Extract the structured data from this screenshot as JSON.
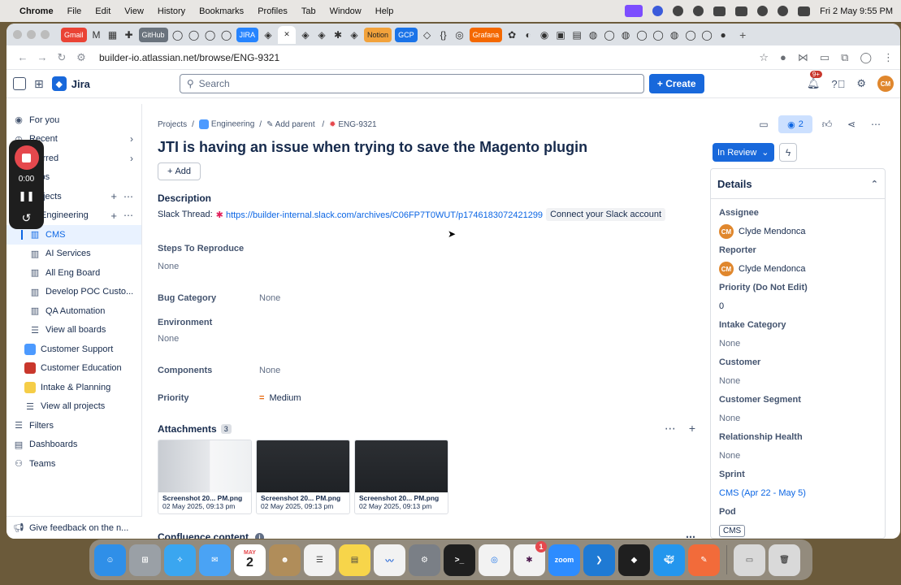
{
  "menubar": {
    "app": "Chrome",
    "items": [
      "File",
      "Edit",
      "View",
      "History",
      "Bookmarks",
      "Profiles",
      "Tab",
      "Window",
      "Help"
    ],
    "clock": "Fri 2 May  9:55 PM"
  },
  "tabs": {
    "labels": [
      "Gmail",
      "GitHub",
      "JIRA",
      "Notion",
      "GCP",
      "Grafana"
    ]
  },
  "browser": {
    "url": "builder-io.atlassian.net/browse/ENG-9321"
  },
  "jira": {
    "brand": "Jira",
    "search_placeholder": "Search",
    "create_label": "Create",
    "notif_badge": "9+",
    "avatar_initials": "CM"
  },
  "sidebar": {
    "for_you": "For you",
    "recent": "Recent",
    "starred": "Starred",
    "apps": "Apps",
    "projects": "Projects",
    "engineering": "Engineering",
    "boards": [
      "CMS",
      "AI Services",
      "All Eng Board",
      "Develop POC Custo...",
      "QA Automation",
      "View all boards"
    ],
    "projects_list": [
      "Customer Support",
      "Customer Education",
      "Intake & Planning",
      "View all projects"
    ],
    "filters": "Filters",
    "dashboards": "Dashboards",
    "teams": "Teams",
    "feedback": "Give feedback on the n..."
  },
  "recorder": {
    "time": "0:00"
  },
  "breadcrumb": {
    "projects": "Projects",
    "engineering": "Engineering",
    "add_parent": "Add parent",
    "issue_key": "ENG-9321"
  },
  "issue": {
    "title": "JTI is having an issue when trying to save the Magento plugin",
    "add_label": "Add",
    "description_heading": "Description",
    "slack_label": "Slack Thread:",
    "slack_url": "https://builder-internal.slack.com/archives/C06FP7T0WUT/p1746183072421299",
    "slack_connect": "Connect your Slack account",
    "steps_label": "Steps To Reproduce",
    "steps_value": "None",
    "bug_category_label": "Bug Category",
    "bug_category_value": "None",
    "environment_label": "Environment",
    "environment_value": "None",
    "components_label": "Components",
    "components_value": "None",
    "priority_label": "Priority",
    "priority_value": "Medium",
    "attachments_label": "Attachments",
    "attachments_count": "3",
    "attachments": [
      {
        "name": "Screenshot 20...   PM.png",
        "date": "02 May 2025, 09:13 pm"
      },
      {
        "name": "Screenshot 20...   PM.png",
        "date": "02 May 2025, 09:13 pm"
      },
      {
        "name": "Screenshot 20...   PM.png",
        "date": "02 May 2025, 09:13 pm"
      }
    ],
    "confluence_label": "Confluence content"
  },
  "panel": {
    "watchers": "2",
    "status": "In Review",
    "details_heading": "Details",
    "assignee_label": "Assignee",
    "assignee": "Clyde Mendonca",
    "reporter_label": "Reporter",
    "reporter": "Clyde Mendonca",
    "priority_dne_label": "Priority (Do Not Edit)",
    "priority_dne": "0",
    "intake_label": "Intake Category",
    "intake": "None",
    "customer_label": "Customer",
    "customer": "None",
    "segment_label": "Customer Segment",
    "segment": "None",
    "health_label": "Relationship Health",
    "health": "None",
    "sprint_label": "Sprint",
    "sprint": "CMS (Apr 22 - May 5)",
    "pod_label": "Pod",
    "pod": "CMS"
  },
  "dock": {
    "calendar_month": "MAY",
    "calendar_day": "2",
    "slack_badge": "1",
    "zoom_label": "zoom"
  }
}
